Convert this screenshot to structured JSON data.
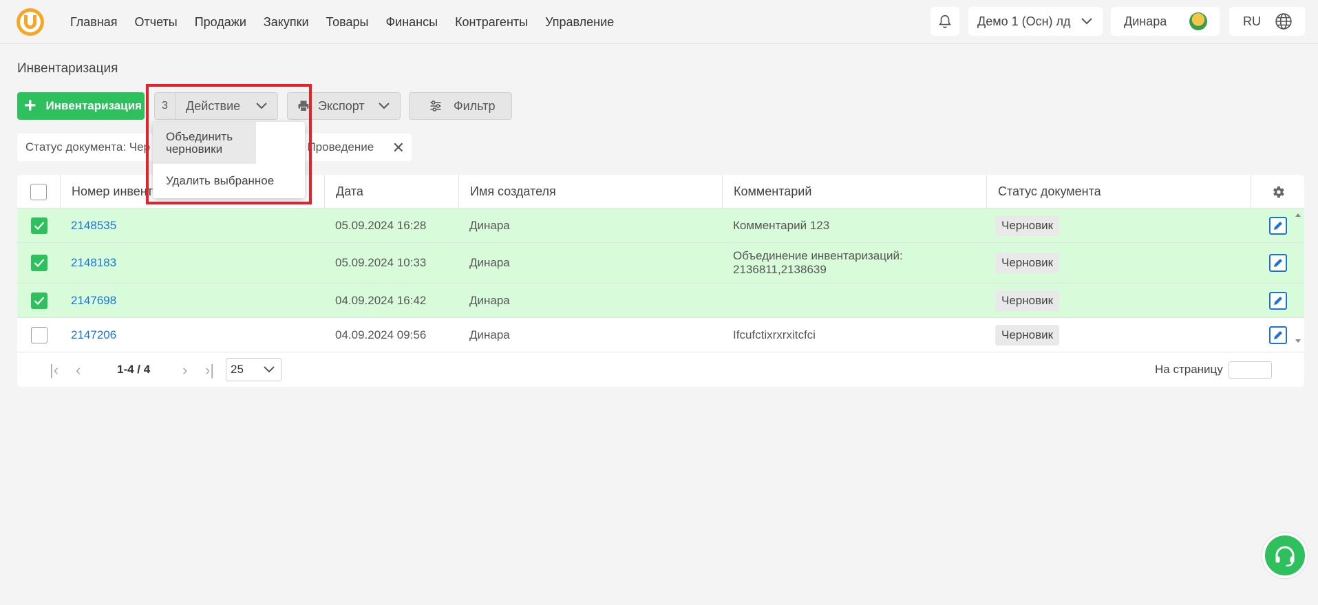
{
  "nav": {
    "items": [
      "Главная",
      "Отчеты",
      "Продажи",
      "Закупки",
      "Товары",
      "Финансы",
      "Контрагенты",
      "Управление"
    ],
    "company": "Демо 1 (Осн) лд",
    "user": "Динара",
    "lang": "RU"
  },
  "page": {
    "title": "Инвентаризация"
  },
  "toolbar": {
    "add_label": "Инвентаризация",
    "selected_count": "3",
    "action_label": "Действие",
    "export_label": "Экспорт",
    "filter_label": "Фильтр"
  },
  "filter_chip": {
    "left_text": "Статус документа: Чер",
    "right_text": ", Проведение"
  },
  "dropdown": {
    "items": [
      "Объединить черновики",
      "Удалить выбранное"
    ]
  },
  "table": {
    "columns": [
      "Номер инвента",
      "Дата",
      "Имя создателя",
      "Комментарий",
      "Статус документа"
    ],
    "rows": [
      {
        "number": "2148535",
        "date": "05.09.2024 16:28",
        "creator": "Динара",
        "comment": "Комментарий 123",
        "status": "Черновик",
        "selected": true
      },
      {
        "number": "2148183",
        "date": "05.09.2024 10:33",
        "creator": "Динара",
        "comment": "Объединение инвентаризаций: 2136811,2138639",
        "status": "Черновик",
        "selected": true
      },
      {
        "number": "2147698",
        "date": "04.09.2024 16:42",
        "creator": "Динара",
        "comment": "",
        "status": "Черновик",
        "selected": true
      },
      {
        "number": "2147206",
        "date": "04.09.2024 09:56",
        "creator": "Динара",
        "comment": "Ifcufctixrxrxitcfci",
        "status": "Черновик",
        "selected": false
      }
    ]
  },
  "pagination": {
    "range": "1-4 / 4",
    "page_size": "25",
    "per_page_label": "На страницу"
  },
  "colors": {
    "accent": "#2ec05d",
    "link": "#1a73d8",
    "selected_row": "#d8fcd9",
    "highlight": "#e8202a"
  }
}
